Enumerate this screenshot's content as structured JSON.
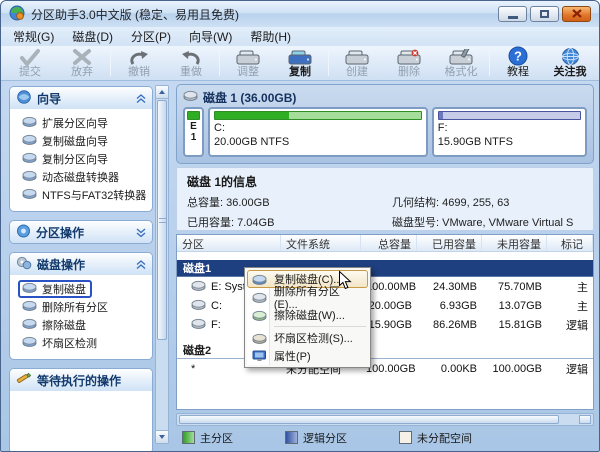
{
  "window": {
    "title": "分区助手3.0中文版 (稳定、易用且免费)",
    "controls": [
      {
        "name": "minimize",
        "glyph": "minimize"
      },
      {
        "name": "maximize",
        "glyph": "maximize"
      },
      {
        "name": "close",
        "glyph": "close"
      }
    ]
  },
  "menu_bar": {
    "items": [
      "常规(G)",
      "磁盘(D)",
      "分区(P)",
      "向导(W)",
      "帮助(H)"
    ]
  },
  "toolbar": {
    "buttons": [
      {
        "label": "提交",
        "icon": "commit-check",
        "enabled": false
      },
      {
        "label": "放弃",
        "icon": "discard-x",
        "enabled": false
      },
      {
        "sep": true
      },
      {
        "label": "撤销",
        "icon": "undo-arrow",
        "enabled": false
      },
      {
        "label": "重做",
        "icon": "redo-arrow",
        "enabled": false
      },
      {
        "sep": true
      },
      {
        "label": "调整",
        "icon": "hdd-gray",
        "enabled": false
      },
      {
        "label": "复制",
        "icon": "hdd-copy",
        "enabled": true,
        "bold": true
      },
      {
        "sep": true
      },
      {
        "label": "创建",
        "icon": "hdd-gray",
        "enabled": false
      },
      {
        "label": "删除",
        "icon": "hdd-delete",
        "enabled": false
      },
      {
        "label": "格式化",
        "icon": "hdd-format",
        "enabled": false
      },
      {
        "sep": true
      },
      {
        "label": "教程",
        "icon": "question-circle",
        "enabled": true
      },
      {
        "label": "关注我",
        "icon": "globe",
        "enabled": true,
        "bold": true
      }
    ]
  },
  "sidebar": {
    "panels": [
      {
        "title": "向导",
        "icon": "wizard",
        "state": "expanded",
        "chevron": "up",
        "items": [
          {
            "label": "扩展分区向导"
          },
          {
            "label": "复制磁盘向导"
          },
          {
            "label": "复制分区向导"
          },
          {
            "label": "动态磁盘转换器"
          },
          {
            "label": "NTFS与FAT32转换器"
          }
        ]
      },
      {
        "title": "分区操作",
        "icon": "partition-ops",
        "state": "collapsed",
        "chevron": "down",
        "items": []
      },
      {
        "title": "磁盘操作",
        "icon": "disk-ops",
        "state": "expanded",
        "chevron": "up",
        "items": [
          {
            "label": "复制磁盘",
            "selected": true
          },
          {
            "label": "删除所有分区"
          },
          {
            "label": "擦除磁盘"
          },
          {
            "label": "坏扇区检测"
          }
        ]
      },
      {
        "title": "等待执行的操作",
        "icon": "pending-ops",
        "state": "open-empty",
        "chevron": "none",
        "items": []
      }
    ]
  },
  "main": {
    "disk_overview": {
      "title": "磁盘 1 (36.00GB)",
      "blocks": [
        {
          "kind": "primary-mini",
          "line1": "E",
          "line2": "1"
        },
        {
          "kind": "primary",
          "name": "C:",
          "size": "20.00GB NTFS",
          "used_pct": 36,
          "flex": 1.45
        },
        {
          "kind": "logical",
          "name": "F:",
          "size": "15.90GB NTFS",
          "used_pct": 3,
          "flex": 1
        }
      ]
    },
    "disk_info": {
      "title": "磁盘 1的信息",
      "fields": [
        {
          "label": "总容量:",
          "value": "36.00GB"
        },
        {
          "label": "几何结构:",
          "value": "4699, 255, 63"
        },
        {
          "label": "已用容量:",
          "value": "7.04GB"
        },
        {
          "label": "磁盘型号:",
          "value": "VMware, VMware Virtual S"
        }
      ]
    },
    "table": {
      "headers": [
        "分区",
        "文件系统",
        "总容量",
        "已用容量",
        "未用容量",
        "标记"
      ],
      "rows": [
        {
          "type": "group",
          "name": "磁盘1",
          "selected": true
        },
        {
          "type": "part",
          "name": "E: System",
          "fs": "",
          "total": "100.00MB",
          "used": "24.30MB",
          "free": "75.70MB",
          "mark": "主"
        },
        {
          "type": "part",
          "name": "C:",
          "fs": "",
          "total": "20.00GB",
          "used": "6.93GB",
          "free": "13.07GB",
          "mark": "主"
        },
        {
          "type": "part",
          "name": "F:",
          "fs": "",
          "total": "15.90GB",
          "used": "86.26MB",
          "free": "15.81GB",
          "mark": "逻辑"
        },
        {
          "type": "group",
          "name": "磁盘2",
          "selected": false
        },
        {
          "type": "part",
          "name": "*",
          "no_icon": true,
          "fs": "未分配空间",
          "total": "100.00GB",
          "used": "0.00KB",
          "free": "100.00GB",
          "mark": "逻辑"
        }
      ]
    },
    "legend": [
      {
        "label": "主分区",
        "swatch": "primary"
      },
      {
        "label": "逻辑分区",
        "swatch": "logical"
      },
      {
        "label": "未分配空间",
        "swatch": "unallocated"
      }
    ]
  },
  "context_menu": {
    "items": [
      {
        "label": "复制磁盘(C)...",
        "icon": "copy-disk",
        "highlighted": true
      },
      {
        "label": "删除所有分区(E)...",
        "icon": "delete-partitions"
      },
      {
        "label": "擦除磁盘(W)...",
        "icon": "wipe-disk"
      },
      {
        "sep": true
      },
      {
        "label": "坏扇区检测(S)...",
        "icon": "bad-sector"
      },
      {
        "label": "属性(P)",
        "icon": "properties"
      }
    ]
  },
  "colors": {
    "selected_row": "#1e3f80",
    "primary_green_dark": "#2fae24",
    "primary_green_light": "#a5dd9a",
    "logical_blue_dark": "#31529f",
    "logical_blue_light": "#c6cbe8",
    "unallocated": "#f5f1e6",
    "close_button": "#e0742a",
    "panel_header_text": "#123a6d"
  }
}
